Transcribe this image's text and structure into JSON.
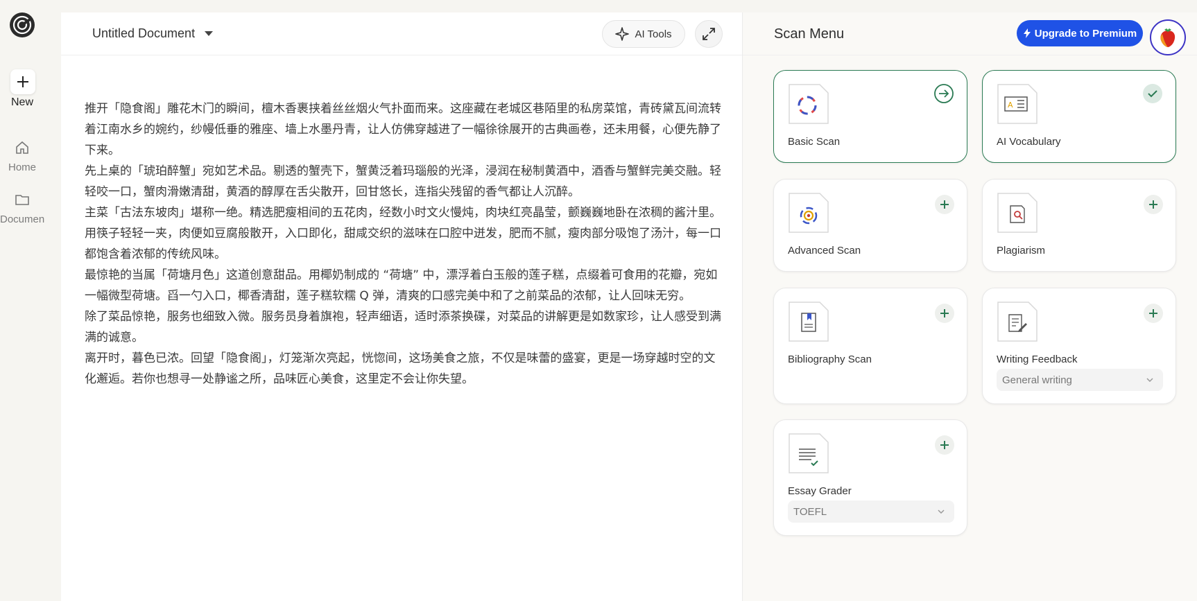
{
  "rail": {
    "new_label": "New",
    "home_label": "Home",
    "documents_label": "Documen"
  },
  "editor": {
    "title": "Untitled Document",
    "ai_tools_label": "AI Tools",
    "paragraphs": [
      "推开「隐食阁」雕花木门的瞬间，檀木香裹挟着丝丝烟火气扑面而来。这座藏在老城区巷陌里的私房菜馆，青砖黛瓦间流转着江南水乡的婉约，纱幔低垂的雅座、墙上水墨丹青，让人仿佛穿越进了一幅徐徐展开的古典画卷，还未用餐，心便先静了下来。",
      "先上桌的「琥珀醉蟹」宛如艺术品。剔透的蟹壳下，蟹黄泛着玛瑙般的光泽，浸润在秘制黄酒中，酒香与蟹鲜完美交融。轻轻咬一口，蟹肉滑嫩清甜，黄酒的醇厚在舌尖散开，回甘悠长，连指尖残留的香气都让人沉醉。",
      "主菜「古法东坡肉」堪称一绝。精选肥瘦相间的五花肉，经数小时文火慢炖，肉块红亮晶莹，颤巍巍地卧在浓稠的酱汁里。用筷子轻轻一夹，肉便如豆腐般散开，入口即化，甜咸交织的滋味在口腔中迸发，肥而不腻，瘦肉部分吸饱了汤汁，每一口都饱含着浓郁的传统风味。",
      "最惊艳的当属「荷塘月色」这道创意甜品。用椰奶制成的 “荷塘” 中，漂浮着白玉般的莲子糕，点缀着可食用的花瓣，宛如一幅微型荷塘。舀一勺入口，椰香清甜，莲子糕软糯 Q 弹，清爽的口感完美中和了之前菜品的浓郁，让人回味无穷。",
      "除了菜品惊艳，服务也细致入微。服务员身着旗袍，轻声细语，适时添茶换碟，对菜品的讲解更是如数家珍，让人感受到满满的诚意。",
      "离开时，暮色已浓。回望「隐食阁」，灯笼渐次亮起，恍惚间，这场美食之旅，不仅是味蕾的盛宴，更是一场穿越时空的文化邂逅。若你也想寻一处静谧之所，品味匠心美食，这里定不会让你失望。"
    ]
  },
  "scan": {
    "title": "Scan Menu",
    "upgrade_label": "Upgrade to Premium",
    "cards": {
      "basic": {
        "label": "Basic Scan"
      },
      "vocab": {
        "label": "AI Vocabulary"
      },
      "advanced": {
        "label": "Advanced Scan"
      },
      "plagiarism": {
        "label": "Plagiarism"
      },
      "bibliography": {
        "label": "Bibliography Scan"
      },
      "feedback": {
        "label": "Writing Feedback",
        "select_value": "General writing"
      },
      "essay": {
        "label": "Essay Grader",
        "select_value": "TOEFL"
      }
    }
  },
  "colors": {
    "accent_green": "#2a7a53",
    "premium_blue": "#1f52e6",
    "avatar_ring": "#3d34c5"
  },
  "icons": [
    "logo-icon",
    "plus-icon",
    "home-icon",
    "folder-icon",
    "chevron-down-icon",
    "sparkle-icon",
    "expand-icon",
    "lightning-icon",
    "arrow-right-circle-icon",
    "check-circle-icon",
    "document-icon",
    "chevron-down-icon"
  ]
}
